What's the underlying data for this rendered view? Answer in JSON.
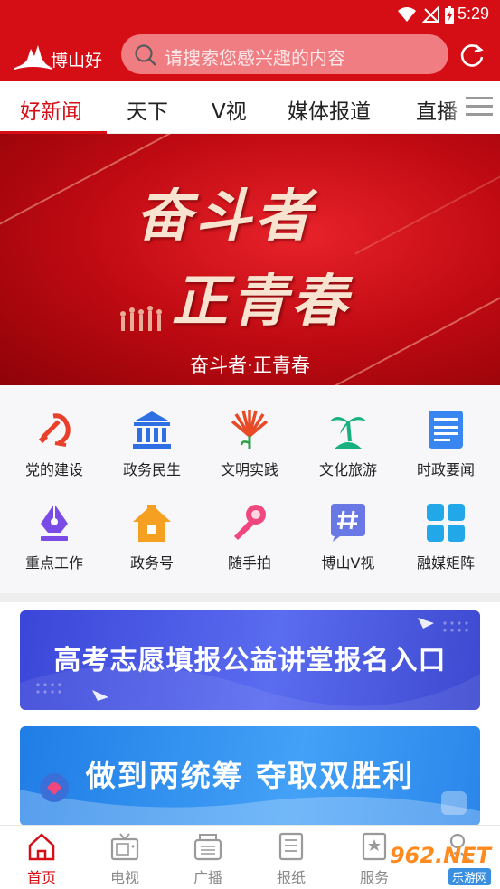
{
  "status_bar": {
    "time": "5:29"
  },
  "header": {
    "logo_text": "博山好",
    "search_placeholder": "请搜索您感兴趣的内容"
  },
  "tabs": [
    {
      "label": "好新闻",
      "active": true
    },
    {
      "label": "天下"
    },
    {
      "label": "V视"
    },
    {
      "label": "媒体报道"
    },
    {
      "label": "直播"
    }
  ],
  "banner": {
    "title_line1": "奋斗者",
    "title_line2": "正青春",
    "caption": "奋斗者·正青春"
  },
  "grid": [
    {
      "label": "党的建设",
      "icon": "party-emblem-icon"
    },
    {
      "label": "政务民生",
      "icon": "government-building-icon"
    },
    {
      "label": "文明实践",
      "icon": "fan-flower-icon"
    },
    {
      "label": "文化旅游",
      "icon": "palm-tree-icon"
    },
    {
      "label": "时政要闻",
      "icon": "newspaper-icon"
    },
    {
      "label": "重点工作",
      "icon": "pen-nib-icon"
    },
    {
      "label": "政务号",
      "icon": "house-icon"
    },
    {
      "label": "随手拍",
      "icon": "microphone-icon"
    },
    {
      "label": "博山V视",
      "icon": "hashtag-chat-icon"
    },
    {
      "label": "融媒矩阵",
      "icon": "matrix-grid-icon"
    }
  ],
  "cards": [
    {
      "text": "高考志愿填报公益讲堂报名入口"
    },
    {
      "text": "做到两统筹  夺取双胜利"
    }
  ],
  "bottom_nav": [
    {
      "label": "首页",
      "icon": "home-icon",
      "active": true
    },
    {
      "label": "电视",
      "icon": "tv-icon"
    },
    {
      "label": "广播",
      "icon": "radio-icon"
    },
    {
      "label": "报纸",
      "icon": "newspaper-nav-icon"
    },
    {
      "label": "服务",
      "icon": "service-icon"
    },
    {
      "label": "",
      "icon": "user-icon"
    }
  ],
  "watermark": {
    "main": "962.NET",
    "sub": "乐游网"
  },
  "colors": {
    "brand_red": "#d50d14",
    "card1": "#3f4bd6",
    "card2": "#2a8aea"
  }
}
